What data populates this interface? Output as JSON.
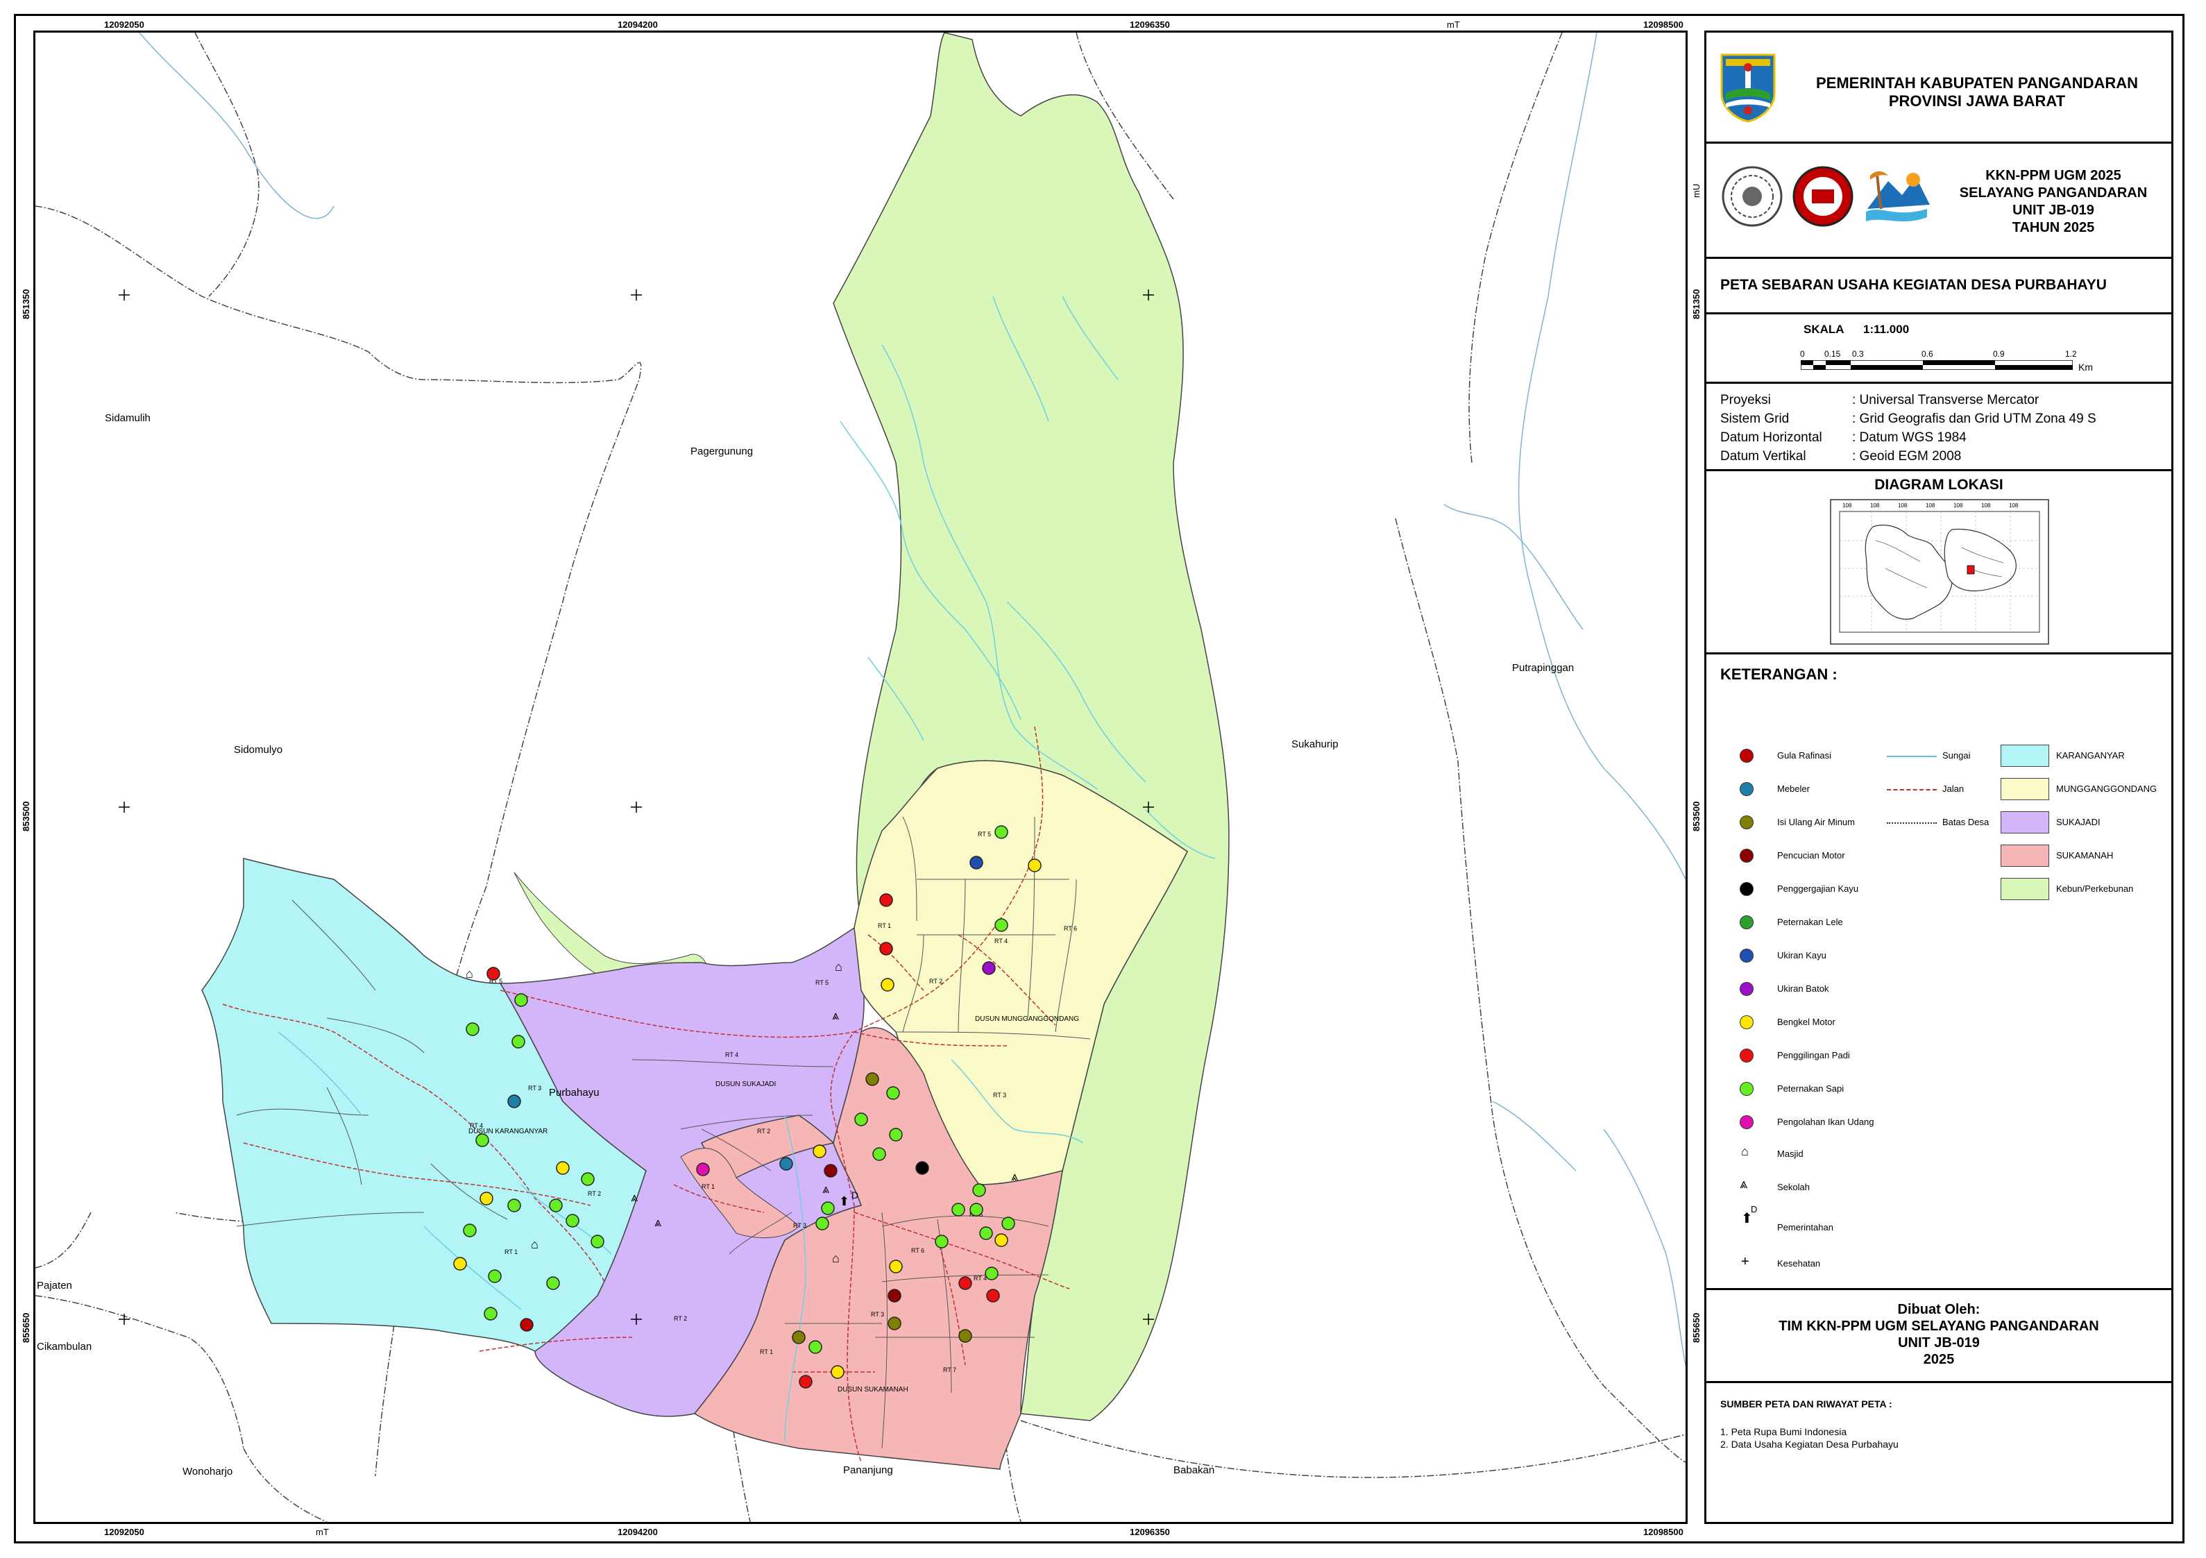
{
  "grid_labels": {
    "top": [
      "12092050",
      "12094200",
      "12096350",
      "mT",
      "12098500"
    ],
    "bottom": [
      "12092050",
      "mT",
      "12094200",
      "12096350",
      "12098500"
    ],
    "left": [
      "851350",
      "853500",
      "855650"
    ],
    "right": [
      "mU",
      "851350",
      "853500",
      "855650"
    ]
  },
  "map_labels": {
    "villages": [
      "Sidamulih",
      "Pagergunung",
      "Sidomulyo",
      "Sukahurip",
      "Putrapinggan",
      "Purbahayu",
      "Pajaten",
      "Cikambulan",
      "Wonoharjo",
      "Pananjung",
      "Babakan"
    ],
    "dusun": [
      "DUSUN MUNGGANGGONDANG",
      "DUSUN SUKAJADI",
      "DUSUN KARANGANYAR",
      "DUSUN SUKAMANAH"
    ],
    "rt": [
      "RT 5",
      "RT 1",
      "RT 2",
      "RT 4",
      "RT 6",
      "RT 3",
      "RT 4",
      "RT 5",
      "RT 2",
      "RT 1",
      "RT 3",
      "RT 2",
      "RT 3",
      "RT 4",
      "RT 2",
      "RT 1",
      "RT 5",
      "RT 6",
      "RT 5",
      "RT 4",
      "RT 3",
      "RT 1",
      "RT 7"
    ]
  },
  "header": {
    "gov_line1": "PEMERINTAH KABUPATEN PANGANDARAN",
    "gov_line2": "PROVINSI JAWA BARAT",
    "kkn_line1": "KKN-PPM UGM 2025",
    "kkn_line2": "SELAYANG PANGANDARAN",
    "kkn_line3": "UNIT JB-019",
    "kkn_line4": "TAHUN 2025"
  },
  "title": "PETA SEBARAN USAHA KEGIATAN DESA PURBAHAYU",
  "scale": {
    "label": "SKALA",
    "value": "1:11.000",
    "ticks": [
      "0",
      "0.15",
      "0.3",
      "0.6",
      "0.9",
      "1.2"
    ],
    "unit": "Km"
  },
  "projection": {
    "rows": [
      {
        "key": "Proyeksi",
        "value": ": Universal Transverse Mercator"
      },
      {
        "key": "Sistem Grid",
        "value": ": Grid Geografis dan Grid UTM Zona 49 S"
      },
      {
        "key": "Datum Horizontal",
        "value": ": Datum WGS 1984"
      },
      {
        "key": "Datum Vertikal",
        "value": ": Geoid EGM 2008"
      }
    ]
  },
  "inset": {
    "title": "DIAGRAM LOKASI",
    "ticks": [
      "108",
      "108",
      "108",
      "108",
      "108",
      "108",
      "108"
    ]
  },
  "legend": {
    "title": "KETERANGAN :",
    "points": [
      {
        "label": "Gula Rafinasi",
        "color": "#c00000"
      },
      {
        "label": "Mebeler",
        "color": "#1f7fa8"
      },
      {
        "label": "Isi Ulang Air Minum",
        "color": "#808000"
      },
      {
        "label": "Pencucian Motor",
        "color": "#8b0000"
      },
      {
        "label": "Penggergajian Kayu",
        "color": "#000000"
      },
      {
        "label": "Peternakan Lele",
        "color": "#2ca02c"
      },
      {
        "label": "Ukiran Kayu",
        "color": "#1f4fb0"
      },
      {
        "label": "Ukiran Batok",
        "color": "#9b10c8"
      },
      {
        "label": "Bengkel Motor",
        "color": "#ffe600"
      },
      {
        "label": "Penggilingan Padi",
        "color": "#e81010"
      },
      {
        "label": "Peternakan Sapi",
        "color": "#66ee22"
      },
      {
        "label": "Pengolahan Ikan Udang",
        "color": "#e010b0"
      }
    ],
    "symbols": [
      {
        "label": "Masjid",
        "icon": "mosque-icon"
      },
      {
        "label": "Sekolah",
        "icon": "school-icon"
      },
      {
        "label": "Pemerintahan",
        "icon": "government-icon"
      },
      {
        "label": "Kesehatan",
        "icon": "health-cross-icon"
      }
    ],
    "lines": [
      {
        "label": "Sungai",
        "color": "#5fc0e0"
      },
      {
        "label": "Jalan",
        "color": "#c03030"
      },
      {
        "label": "Batas Desa",
        "color": "#333333"
      }
    ],
    "areas": [
      {
        "label": "KARANGANYAR",
        "color": "#b3f4f7"
      },
      {
        "label": "MUNGGANGGONDANG",
        "color": "#fafac8"
      },
      {
        "label": "SUKAJADI",
        "color": "#d3b6fa"
      },
      {
        "label": "SUKAMANAH",
        "color": "#f7b6b6"
      },
      {
        "label": "Kebun/Perkebunan",
        "color": "#d8f7b8"
      }
    ]
  },
  "author": {
    "line1": "Dibuat Oleh:",
    "line2": "TIM KKN-PPM UGM SELAYANG PANGANDARAN",
    "line3": "UNIT JB-019",
    "line4": "2025"
  },
  "sources": {
    "title": "SUMBER PETA DAN RIWAYAT PETA :",
    "items": [
      "1. Peta Rupa Bumi Indonesia",
      "2. Data Usaha Kegiatan Desa Purbahayu"
    ]
  }
}
